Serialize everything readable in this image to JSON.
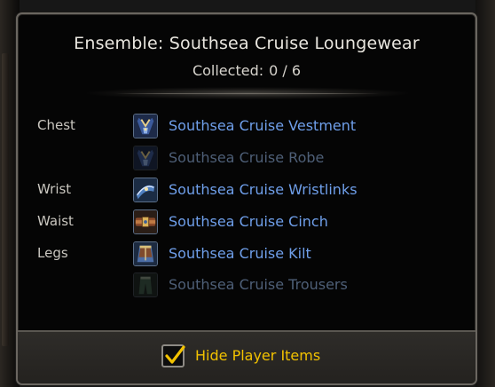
{
  "header": {
    "title": "Ensemble: Southsea Cruise Loungewear",
    "collected_label": "Collected:",
    "collected_value": "0 / 6"
  },
  "items": [
    {
      "slot": "Chest",
      "name": "Southsea Cruise Vestment",
      "icon": "vestment-icon",
      "collected": false,
      "dim": false
    },
    {
      "slot": "",
      "name": "Southsea Cruise Robe",
      "icon": "robe-icon",
      "collected": false,
      "dim": true
    },
    {
      "slot": "Wrist",
      "name": "Southsea Cruise Wristlinks",
      "icon": "wristlinks-icon",
      "collected": false,
      "dim": false
    },
    {
      "slot": "Waist",
      "name": "Southsea Cruise Cinch",
      "icon": "cinch-icon",
      "collected": false,
      "dim": false
    },
    {
      "slot": "Legs",
      "name": "Southsea Cruise Kilt",
      "icon": "kilt-icon",
      "collected": false,
      "dim": false
    },
    {
      "slot": "",
      "name": "Southsea Cruise Trousers",
      "icon": "trousers-icon",
      "collected": false,
      "dim": true
    }
  ],
  "footer": {
    "checkbox_checked": true,
    "label": "Hide Player Items"
  },
  "colors": {
    "item_link": "#6f9fea",
    "item_link_dim": "#4e5f77",
    "footer_label": "#f2c200",
    "title": "#e9e6df"
  }
}
